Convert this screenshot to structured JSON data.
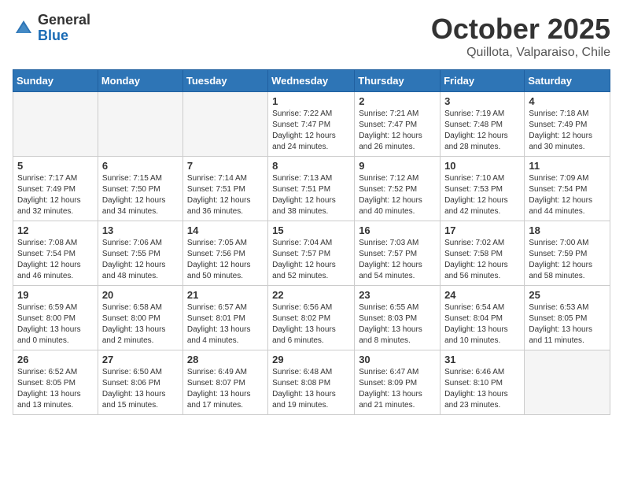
{
  "logo": {
    "general": "General",
    "blue": "Blue"
  },
  "header": {
    "month": "October 2025",
    "location": "Quillota, Valparaiso, Chile"
  },
  "weekdays": [
    "Sunday",
    "Monday",
    "Tuesday",
    "Wednesday",
    "Thursday",
    "Friday",
    "Saturday"
  ],
  "weeks": [
    [
      {
        "day": "",
        "info": ""
      },
      {
        "day": "",
        "info": ""
      },
      {
        "day": "",
        "info": ""
      },
      {
        "day": "1",
        "info": "Sunrise: 7:22 AM\nSunset: 7:47 PM\nDaylight: 12 hours\nand 24 minutes."
      },
      {
        "day": "2",
        "info": "Sunrise: 7:21 AM\nSunset: 7:47 PM\nDaylight: 12 hours\nand 26 minutes."
      },
      {
        "day": "3",
        "info": "Sunrise: 7:19 AM\nSunset: 7:48 PM\nDaylight: 12 hours\nand 28 minutes."
      },
      {
        "day": "4",
        "info": "Sunrise: 7:18 AM\nSunset: 7:49 PM\nDaylight: 12 hours\nand 30 minutes."
      }
    ],
    [
      {
        "day": "5",
        "info": "Sunrise: 7:17 AM\nSunset: 7:49 PM\nDaylight: 12 hours\nand 32 minutes."
      },
      {
        "day": "6",
        "info": "Sunrise: 7:15 AM\nSunset: 7:50 PM\nDaylight: 12 hours\nand 34 minutes."
      },
      {
        "day": "7",
        "info": "Sunrise: 7:14 AM\nSunset: 7:51 PM\nDaylight: 12 hours\nand 36 minutes."
      },
      {
        "day": "8",
        "info": "Sunrise: 7:13 AM\nSunset: 7:51 PM\nDaylight: 12 hours\nand 38 minutes."
      },
      {
        "day": "9",
        "info": "Sunrise: 7:12 AM\nSunset: 7:52 PM\nDaylight: 12 hours\nand 40 minutes."
      },
      {
        "day": "10",
        "info": "Sunrise: 7:10 AM\nSunset: 7:53 PM\nDaylight: 12 hours\nand 42 minutes."
      },
      {
        "day": "11",
        "info": "Sunrise: 7:09 AM\nSunset: 7:54 PM\nDaylight: 12 hours\nand 44 minutes."
      }
    ],
    [
      {
        "day": "12",
        "info": "Sunrise: 7:08 AM\nSunset: 7:54 PM\nDaylight: 12 hours\nand 46 minutes."
      },
      {
        "day": "13",
        "info": "Sunrise: 7:06 AM\nSunset: 7:55 PM\nDaylight: 12 hours\nand 48 minutes."
      },
      {
        "day": "14",
        "info": "Sunrise: 7:05 AM\nSunset: 7:56 PM\nDaylight: 12 hours\nand 50 minutes."
      },
      {
        "day": "15",
        "info": "Sunrise: 7:04 AM\nSunset: 7:57 PM\nDaylight: 12 hours\nand 52 minutes."
      },
      {
        "day": "16",
        "info": "Sunrise: 7:03 AM\nSunset: 7:57 PM\nDaylight: 12 hours\nand 54 minutes."
      },
      {
        "day": "17",
        "info": "Sunrise: 7:02 AM\nSunset: 7:58 PM\nDaylight: 12 hours\nand 56 minutes."
      },
      {
        "day": "18",
        "info": "Sunrise: 7:00 AM\nSunset: 7:59 PM\nDaylight: 12 hours\nand 58 minutes."
      }
    ],
    [
      {
        "day": "19",
        "info": "Sunrise: 6:59 AM\nSunset: 8:00 PM\nDaylight: 13 hours\nand 0 minutes."
      },
      {
        "day": "20",
        "info": "Sunrise: 6:58 AM\nSunset: 8:00 PM\nDaylight: 13 hours\nand 2 minutes."
      },
      {
        "day": "21",
        "info": "Sunrise: 6:57 AM\nSunset: 8:01 PM\nDaylight: 13 hours\nand 4 minutes."
      },
      {
        "day": "22",
        "info": "Sunrise: 6:56 AM\nSunset: 8:02 PM\nDaylight: 13 hours\nand 6 minutes."
      },
      {
        "day": "23",
        "info": "Sunrise: 6:55 AM\nSunset: 8:03 PM\nDaylight: 13 hours\nand 8 minutes."
      },
      {
        "day": "24",
        "info": "Sunrise: 6:54 AM\nSunset: 8:04 PM\nDaylight: 13 hours\nand 10 minutes."
      },
      {
        "day": "25",
        "info": "Sunrise: 6:53 AM\nSunset: 8:05 PM\nDaylight: 13 hours\nand 11 minutes."
      }
    ],
    [
      {
        "day": "26",
        "info": "Sunrise: 6:52 AM\nSunset: 8:05 PM\nDaylight: 13 hours\nand 13 minutes."
      },
      {
        "day": "27",
        "info": "Sunrise: 6:50 AM\nSunset: 8:06 PM\nDaylight: 13 hours\nand 15 minutes."
      },
      {
        "day": "28",
        "info": "Sunrise: 6:49 AM\nSunset: 8:07 PM\nDaylight: 13 hours\nand 17 minutes."
      },
      {
        "day": "29",
        "info": "Sunrise: 6:48 AM\nSunset: 8:08 PM\nDaylight: 13 hours\nand 19 minutes."
      },
      {
        "day": "30",
        "info": "Sunrise: 6:47 AM\nSunset: 8:09 PM\nDaylight: 13 hours\nand 21 minutes."
      },
      {
        "day": "31",
        "info": "Sunrise: 6:46 AM\nSunset: 8:10 PM\nDaylight: 13 hours\nand 23 minutes."
      },
      {
        "day": "",
        "info": ""
      }
    ]
  ]
}
